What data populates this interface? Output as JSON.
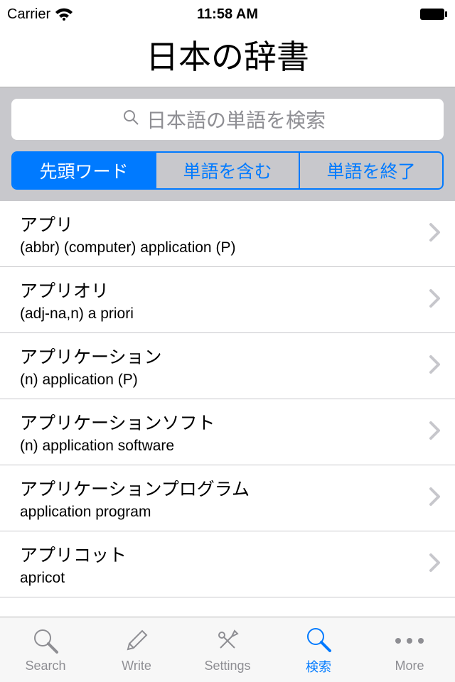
{
  "status": {
    "carrier": "Carrier",
    "time": "11:58 AM"
  },
  "header": {
    "title": "日本の辞書"
  },
  "search": {
    "placeholder": "日本語の単語を検索",
    "segments": [
      "先頭ワード",
      "単語を含む",
      "単語を終了"
    ],
    "selected_index": 0
  },
  "results": [
    {
      "word": "アプリ",
      "def": "(abbr) (computer) application (P)"
    },
    {
      "word": "アプリオリ",
      "def": "(adj-na,n) a priori"
    },
    {
      "word": "アプリケーション",
      "def": "(n) application (P)"
    },
    {
      "word": "アプリケーションソフト",
      "def": "(n) application software"
    },
    {
      "word": "アプリケーションプログラム",
      "def": "application program"
    },
    {
      "word": "アプリコット",
      "def": "apricot"
    }
  ],
  "tabs": [
    {
      "label": "Search",
      "icon": "search-icon",
      "active": false
    },
    {
      "label": "Write",
      "icon": "pencil-icon",
      "active": false
    },
    {
      "label": "Settings",
      "icon": "tools-icon",
      "active": false
    },
    {
      "label": "検索",
      "icon": "search-icon",
      "active": true
    },
    {
      "label": "More",
      "icon": "more-icon",
      "active": false
    }
  ]
}
